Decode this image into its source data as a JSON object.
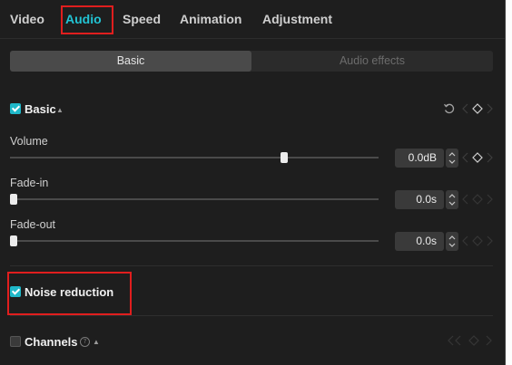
{
  "tabs": [
    {
      "label": "Video"
    },
    {
      "label": "Audio"
    },
    {
      "label": "Speed"
    },
    {
      "label": "Animation"
    },
    {
      "label": "Adjustment"
    }
  ],
  "subtabs": {
    "basic": "Basic",
    "audio_effects": "Audio effects"
  },
  "basic_section": {
    "label": "Basic",
    "checked": true
  },
  "volume": {
    "label": "Volume",
    "value": "0.0dB",
    "slider_fraction": 0.74
  },
  "fade_in": {
    "label": "Fade-in",
    "value": "0.0s",
    "slider_fraction": 0
  },
  "fade_out": {
    "label": "Fade-out",
    "value": "0.0s",
    "slider_fraction": 0
  },
  "noise_reduction": {
    "label": "Noise reduction",
    "checked": true
  },
  "channels": {
    "label": "Channels",
    "checked": false
  },
  "colors": {
    "accent": "#22c4d4",
    "highlight": "#e01e1e",
    "panel_bg": "#1e1e1e"
  }
}
